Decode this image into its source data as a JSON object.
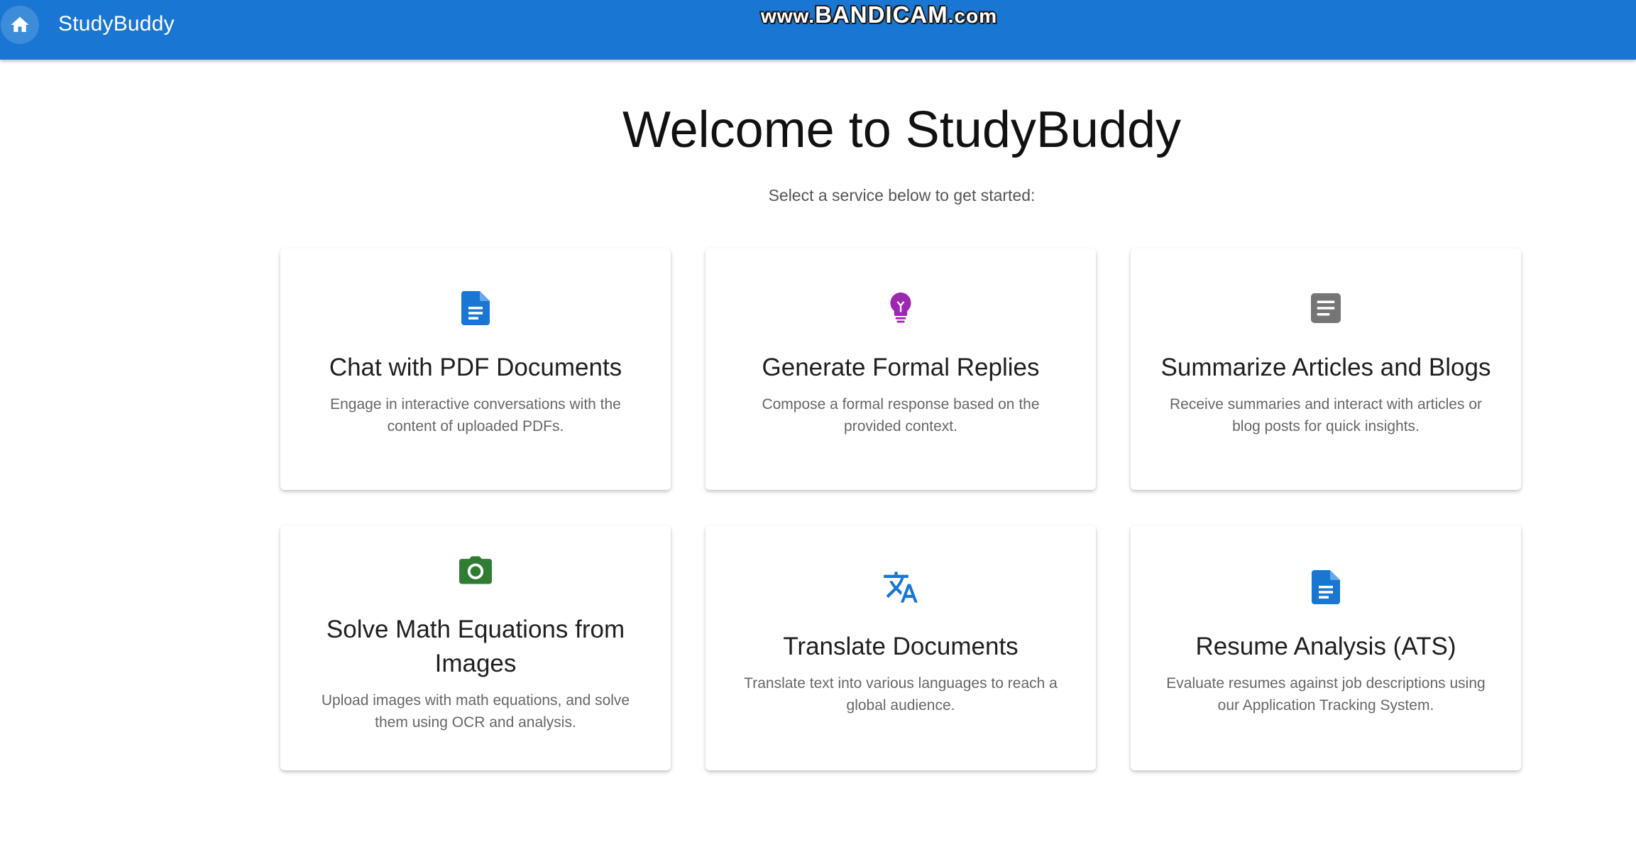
{
  "appbar": {
    "title": "StudyBuddy",
    "home_icon": "home-icon",
    "watermark": {
      "prefix": "www.",
      "brand": "BANDICAM",
      "suffix": ".com"
    },
    "color": "#1976d2"
  },
  "main": {
    "title": "Welcome to StudyBuddy",
    "subtitle": "Select a service below to get started:"
  },
  "cards": [
    {
      "title": "Chat with PDF Documents",
      "description": "Engage in interactive conversations with the content of uploaded PDFs.",
      "icon": "document-icon",
      "icon_color": "#1976d2"
    },
    {
      "title": "Generate Formal Replies",
      "description": "Compose a formal response based on the provided context.",
      "icon": "lightbulb-icon",
      "icon_color": "#9c27b0"
    },
    {
      "title": "Summarize Articles and Blogs",
      "description": "Receive summaries and interact with articles or blog posts for quick insights.",
      "icon": "article-icon",
      "icon_color": "#757575"
    },
    {
      "title": "Solve Math Equations from Images",
      "description": "Upload images with math equations, and solve them using OCR and analysis.",
      "icon": "camera-icon",
      "icon_color": "#2e7d32"
    },
    {
      "title": "Translate Documents",
      "description": "Translate text into various languages to reach a global audience.",
      "icon": "translate-icon",
      "icon_color": "#1976d2"
    },
    {
      "title": "Resume Analysis (ATS)",
      "description": "Evaluate resumes against job descriptions using our Application Tracking System.",
      "icon": "document-icon",
      "icon_color": "#1976d2"
    }
  ]
}
